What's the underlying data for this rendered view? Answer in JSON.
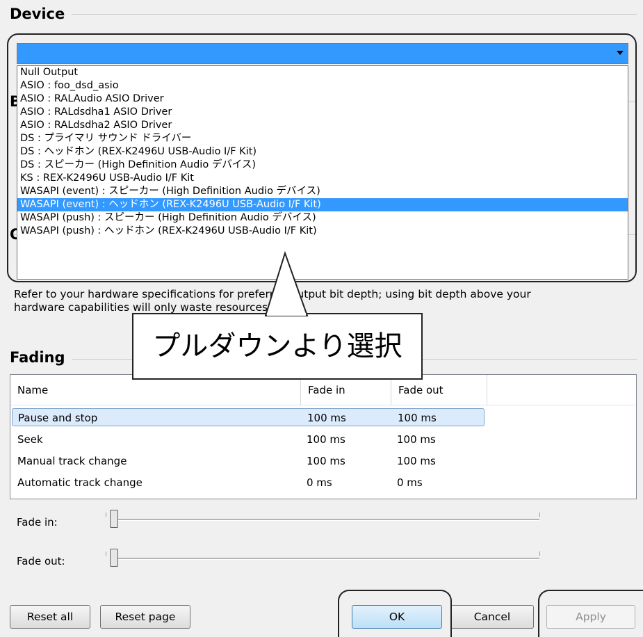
{
  "device": {
    "heading": "Device",
    "options": [
      "Null Output",
      "ASIO : foo_dsd_asio",
      "ASIO : RALAudio ASIO Driver",
      "ASIO : RALdsdha1 ASIO Driver",
      "ASIO : RALdsdha2 ASIO Driver",
      "DS : プライマリ サウンド ドライバー",
      "DS : ヘッドホン (REX-K2496U USB-Audio I/F Kit)",
      "DS : スピーカー (High Definition Audio デバイス)",
      "KS : REX-K2496U USB-Audio I/F Kit",
      "WASAPI (event) : スピーカー (High Definition Audio デバイス)",
      "WASAPI (event) : ヘッドホン (REX-K2496U USB-Audio I/F Kit)",
      "WASAPI (push) : スピーカー (High Definition Audio デバイス)",
      "WASAPI (push) : ヘッドホン (REX-K2496U USB-Audio I/F Kit)"
    ],
    "selected_index": 10
  },
  "output_format": {
    "description_line1": "Refer to your hardware specifications for preferred output bit depth; using bit depth above your",
    "description_line2": "hardware capabilities will only waste resources."
  },
  "annotation": {
    "text": "プルダウンより選択"
  },
  "fading": {
    "heading": "Fading",
    "columns": [
      "Name",
      "Fade in",
      "Fade out"
    ],
    "rows": [
      {
        "name": "Pause and stop",
        "fade_in": "100 ms",
        "fade_out": "100 ms",
        "selected": true
      },
      {
        "name": "Seek",
        "fade_in": "100 ms",
        "fade_out": "100 ms"
      },
      {
        "name": "Manual track change",
        "fade_in": "100 ms",
        "fade_out": "100 ms"
      },
      {
        "name": "Automatic track change",
        "fade_in": "0 ms",
        "fade_out": "0 ms"
      }
    ],
    "fade_in_label": "Fade in:",
    "fade_out_label": "Fade out:",
    "fade_in_level": 0,
    "fade_out_level": 0
  },
  "buttons": {
    "reset_all": "Reset all",
    "reset_page": "Reset page",
    "ok": "OK",
    "cancel": "Cancel",
    "apply": "Apply"
  },
  "colors": {
    "selection": "#3399ff",
    "row_highlight": "#dcebfc"
  }
}
